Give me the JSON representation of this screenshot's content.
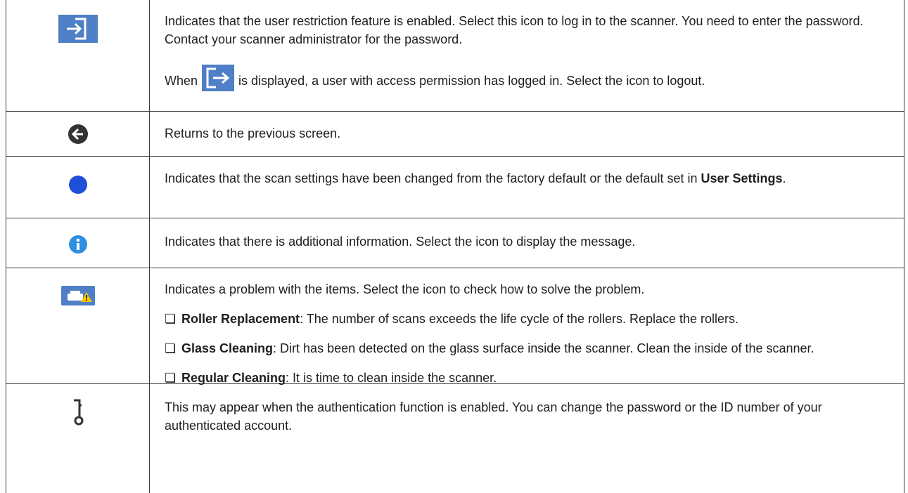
{
  "rows": [
    {
      "icon": "login-icon",
      "p1": "Indicates that the user restriction feature is enabled. Select this icon to log in to the scanner. You need to enter the password. Contact your scanner administrator for the password.",
      "p2_before": "When",
      "p2_icon": "logout-icon",
      "p2_after": "is displayed, a user with access permission has logged in. Select the icon to logout."
    },
    {
      "icon": "back-arrow-icon",
      "text": "Returns to the previous screen."
    },
    {
      "icon": "blue-dot-icon",
      "text_before": "Indicates that the scan settings have been changed from the factory default or the default set in ",
      "text_bold": "User Settings",
      "text_after": "."
    },
    {
      "icon": "info-icon",
      "text": "Indicates that there is additional information. Select the icon to display the message."
    },
    {
      "icon": "scanner-warning-icon",
      "text": "Indicates a problem with the items. Select the icon to check how to solve the problem.",
      "bullets": [
        {
          "title": "Roller Replacement",
          "text": ": The number of scans exceeds the life cycle of the rollers. Replace the rollers."
        },
        {
          "title": "Glass Cleaning",
          "text": ": Dirt has been detected on the glass surface inside the scanner. Clean the inside of the scanner."
        },
        {
          "title": "Regular Cleaning",
          "text": ": It is time to clean inside the scanner."
        }
      ],
      "bullet_mark": "❏"
    },
    {
      "icon": "key-icon",
      "text": "This may appear when the authentication function is enabled. You can change the password or the ID number of your authenticated account."
    }
  ],
  "colors": {
    "icon_blue": "#4f7fc6",
    "dot_blue": "#1f4fd6",
    "info_blue": "#2e8fe0",
    "warning_yellow": "#f5c400",
    "dark_icon": "#333333"
  }
}
